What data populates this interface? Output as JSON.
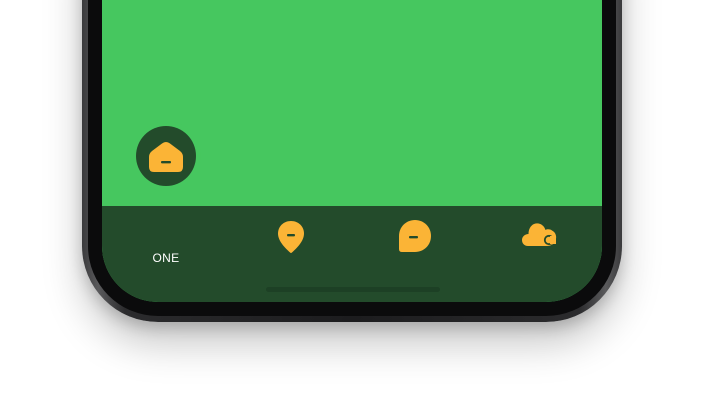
{
  "colors": {
    "screen_background": "#46c75f",
    "tab_bar_background": "#234b2b",
    "icon_color": "#fbb436",
    "active_ring": "#46c75f",
    "label_color": "#ffffff",
    "phone_frame": "#1c1c1e"
  },
  "tab_bar": {
    "active_index": 0,
    "tabs": [
      {
        "label": "ONE",
        "icon": "home-icon",
        "active": true
      },
      {
        "label": "",
        "icon": "map-pin-icon",
        "active": false
      },
      {
        "label": "",
        "icon": "chat-bubble-icon",
        "active": false
      },
      {
        "label": "",
        "icon": "weather-cloud-icon",
        "active": false
      }
    ]
  }
}
